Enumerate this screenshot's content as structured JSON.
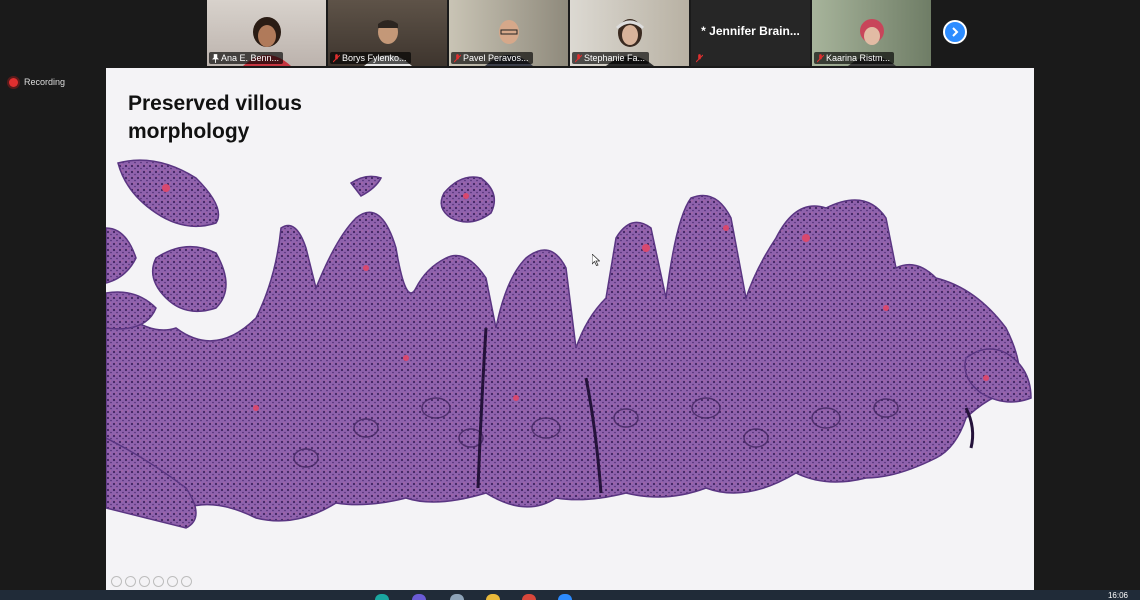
{
  "participants": [
    {
      "name": "Ana E. Benn...",
      "muted": false,
      "pinned": true,
      "active": true
    },
    {
      "name": "Borys Fylenko...",
      "muted": true
    },
    {
      "name": "Pavel Peravos...",
      "muted": true
    },
    {
      "name": "Stephanie Fa...",
      "muted": true
    },
    {
      "name": "* Jennifer Brain...",
      "muted": true,
      "video": false
    },
    {
      "name": "Kaarina Ristm...",
      "muted": true
    }
  ],
  "recording": {
    "label": "Recording"
  },
  "slide": {
    "title": "Preserved villous morphology"
  },
  "taskbar": {
    "time": "16:06"
  },
  "colors": {
    "active_speaker": "#8bd14b",
    "accent": "#2d8cff",
    "recording": "#e02f2f",
    "tissue": "#8a5aa8"
  }
}
